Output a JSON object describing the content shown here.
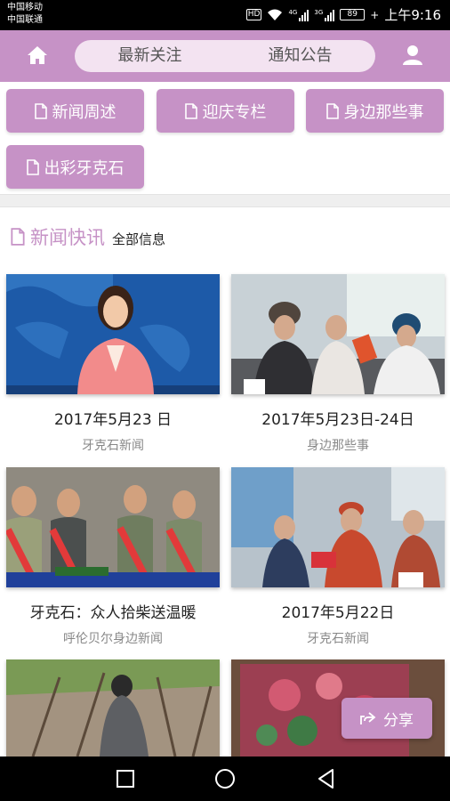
{
  "status_bar": {
    "carrier_1": "中国移动",
    "carrier_2": "中国联通",
    "hd": "HD",
    "net_4g": "4G",
    "net_3g": "3G",
    "battery": "89",
    "time": "上午9:16"
  },
  "header": {
    "tabs": [
      {
        "label": "最新关注"
      },
      {
        "label": "通知公告"
      }
    ],
    "accent": "#c692c6"
  },
  "categories": [
    {
      "label": "新闻周述"
    },
    {
      "label": "迎庆专栏"
    },
    {
      "label": "身边那些事"
    },
    {
      "label": "出彩牙克石"
    }
  ],
  "section": {
    "title": "新闻快讯",
    "subtitle": "全部信息"
  },
  "news": [
    {
      "date": "2017年5月23 日",
      "source": "牙克石新闻"
    },
    {
      "date": "2017年5月23日-24日",
      "source": "身边那些事"
    },
    {
      "date": "牙克石：众人拾柴送温暖",
      "source": "呼伦贝尔身边新闻"
    },
    {
      "date": "2017年5月22日",
      "source": "牙克石新闻"
    }
  ],
  "share": {
    "label": "分享"
  }
}
